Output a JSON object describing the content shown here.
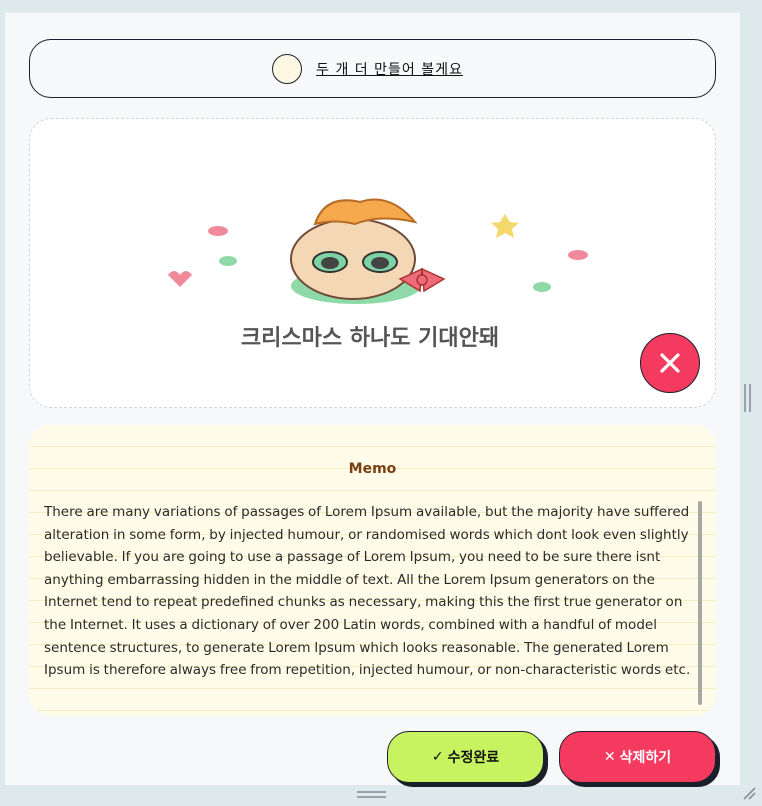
{
  "header": {
    "title": "두 개 더 만들어 볼게요",
    "check_icon": "empty-circle-checkbox"
  },
  "image": {
    "sticker_caption": "크리스마스 하나도 기대안돼",
    "remove_icon": "close-icon"
  },
  "memo": {
    "label": "Memo",
    "text": "There are many variations of passages of Lorem Ipsum available, but the majority have suffered alteration in some form, by injected humour, or randomised words which dont look even slightly believable. If you are going to use a passage of Lorem Ipsum, you need to be sure there isnt anything embarrassing hidden in the middle of text. All the Lorem Ipsum generators on the Internet tend to repeat predefined chunks as necessary, making this the first true generator on the Internet. It uses a dictionary of over 200 Latin words, combined with a handful of model sentence structures, to generate Lorem Ipsum which looks reasonable. The generated Lorem Ipsum is therefore always free from repetition, injected humour, or non-characteristic words etc."
  },
  "actions": {
    "save_icon": "✓",
    "save_label": "수정완료",
    "delete_icon": "✕",
    "delete_label": "삭제하기"
  },
  "colors": {
    "save_accent": "#c8f360",
    "delete_accent": "#f43b5f",
    "memo_bg": "#fefce8",
    "memo_title": "#7a3f13"
  }
}
